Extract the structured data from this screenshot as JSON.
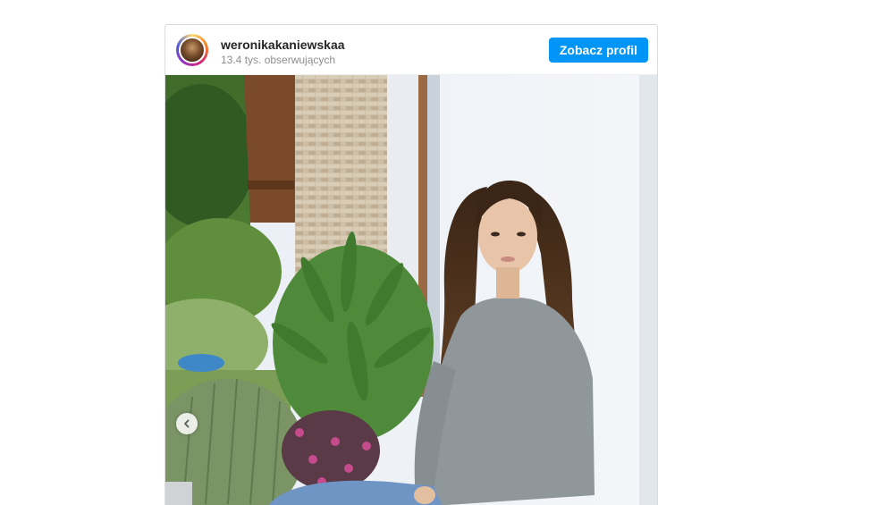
{
  "post": {
    "username": "weronikakaniewskaa",
    "followers": "13.4 tys. obserwujących",
    "view_profile_label": "Zobacz profil",
    "image_alt": "Zdjęcie z Instagrama",
    "carousel": {
      "prev_icon": "chevron-left-icon"
    }
  },
  "colors": {
    "accent": "#0095f6",
    "username": "#262626",
    "secondary_text": "#8e8e8e"
  }
}
